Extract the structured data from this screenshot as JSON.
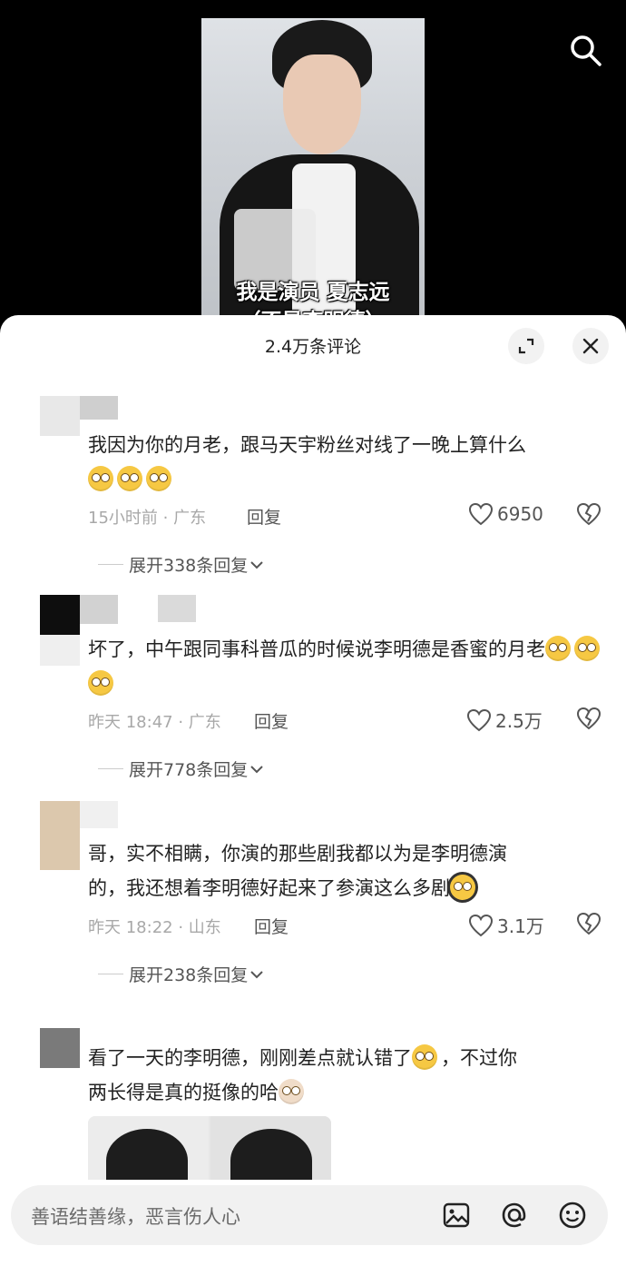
{
  "video": {
    "caption_line1": "我是演员 夏志远",
    "caption_line2": "（不是李明德）"
  },
  "header": {
    "icons": [
      "search-icon"
    ]
  },
  "sheet": {
    "title": "2.4万条评论",
    "icons": [
      "expand-icon",
      "close-icon"
    ]
  },
  "comments": [
    {
      "text": "我因为你的月老，跟马天宇粉丝对线了一晚上算什么",
      "emoji": [
        "flushed-emoji",
        "flushed-emoji",
        "flushed-emoji"
      ],
      "meta": "15小时前 · 广东",
      "reply_label": "回复",
      "likes": "6950",
      "expand_label": "展开338条回复"
    },
    {
      "text": "坏了，中午跟同事科普瓜的时候说李明德是香蜜的月老",
      "emoji": [
        "dizzy-emoji",
        "dizzy-emoji",
        "dizzy-emoji"
      ],
      "meta": "昨天 18:47 · 广东",
      "reply_label": "回复",
      "likes": "2.5万",
      "expand_label": "展开778条回复"
    },
    {
      "text_line1": "哥，实不相瞒，你演的那些剧我都以为是李明德演",
      "text_line2": "的，我还想着李明德好起来了参演这么多剧",
      "emoji": [
        "headphone-emoji"
      ],
      "meta": "昨天 18:22 · 山东",
      "reply_label": "回复",
      "likes": "3.1万",
      "expand_label": "展开238条回复"
    },
    {
      "text_part1": "看了一天的李明德，刚刚差点就认错了",
      "text_part2": "，不过你",
      "text_line2": "两长得是真的挺像的哈",
      "emoji": [
        "laugh-cry-emoji",
        "cat-emoji"
      ]
    }
  ],
  "input": {
    "placeholder": "善语结善缘，恶言伤人心",
    "icons": [
      "image-icon",
      "at-icon",
      "smile-icon"
    ]
  },
  "colors": {
    "background": "#000000",
    "sheet": "#ffffff",
    "muted_text": "#a8a8a8",
    "input_bg": "#f1f1f1"
  }
}
